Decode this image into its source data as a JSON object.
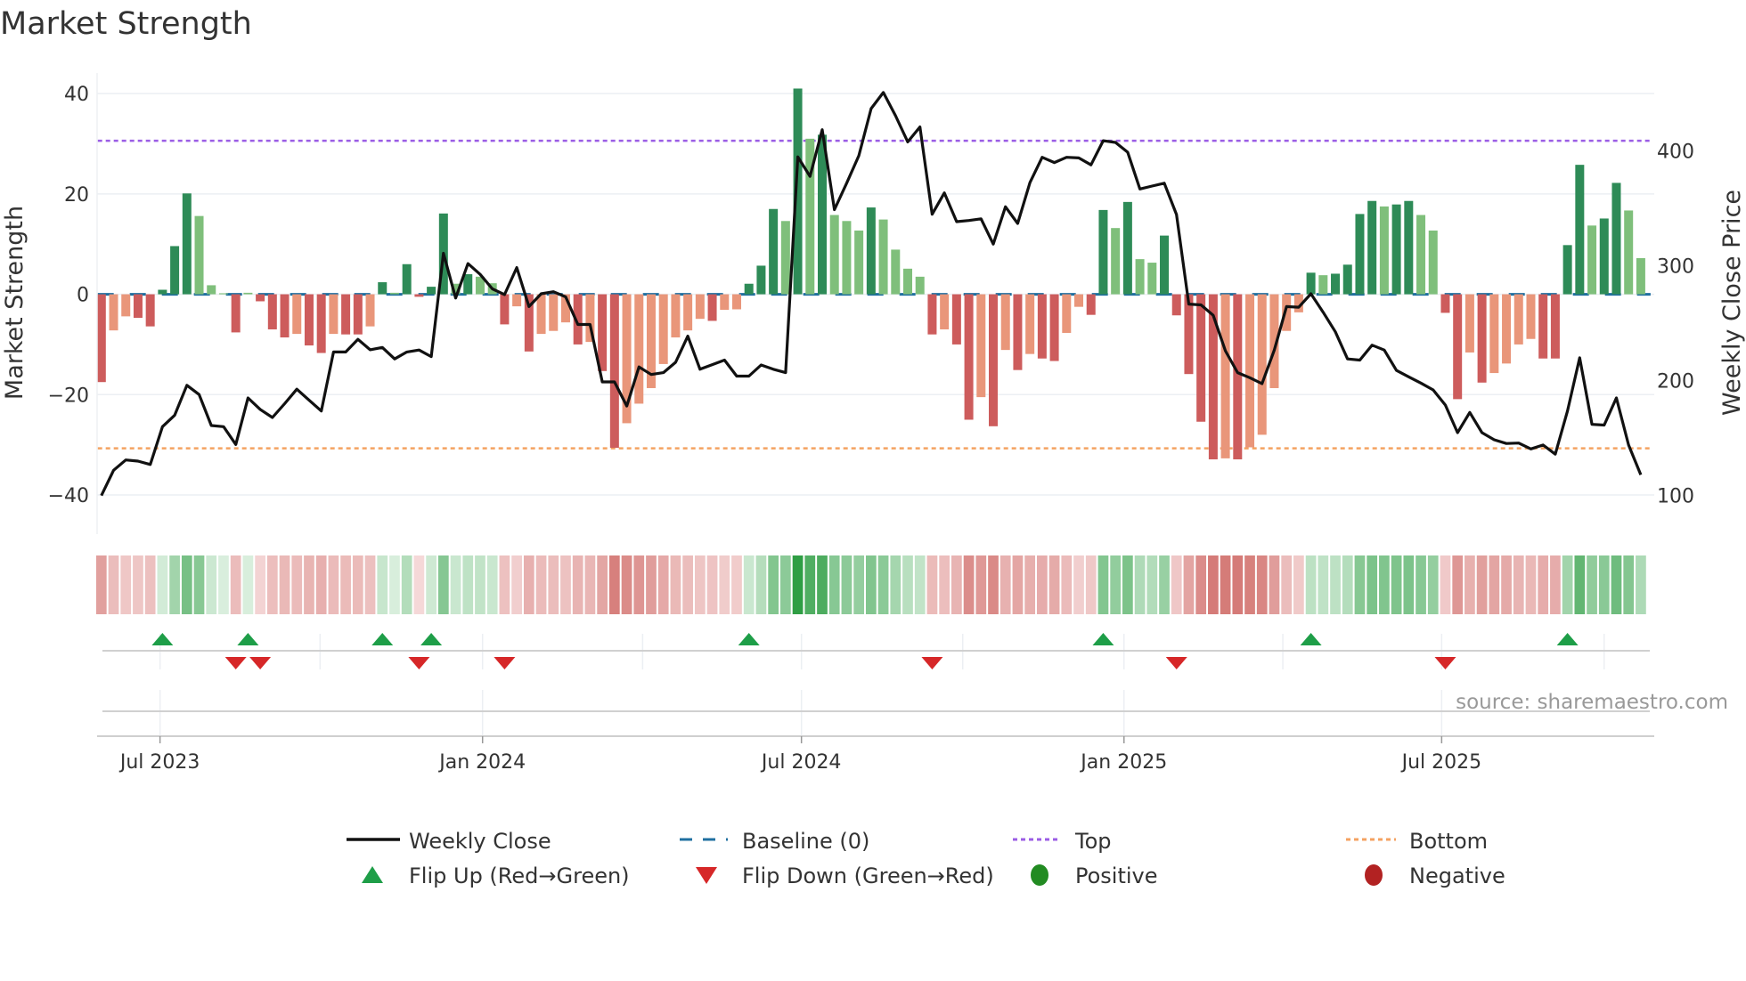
{
  "chart_data": {
    "type": "bar",
    "title": "Market Strength",
    "ylabel": "Market Strength",
    "y2label": "Weekly Close Price",
    "ylim": [
      -47.8,
      44.1
    ],
    "y2lim": [
      66.4,
      468
    ],
    "xlim": [
      -0.35,
      127.1
    ],
    "yticks": [
      40,
      20,
      0,
      -20,
      -40
    ],
    "ytick_labels": [
      "40",
      "20",
      "0",
      "−20",
      "−40"
    ],
    "y2ticks": [
      400,
      300,
      200,
      100
    ],
    "y2tick_labels": [
      "400",
      "300",
      "200",
      "100"
    ],
    "xticks": [
      {
        "label": "Jul 2023",
        "week": 4.8
      },
      {
        "label": "Jan 2024",
        "week": 31.2
      },
      {
        "label": "Jul 2024",
        "week": 57.3
      },
      {
        "label": "Jan 2025",
        "week": 83.7
      },
      {
        "label": "Jul 2025",
        "week": 109.7
      }
    ],
    "minor_xticks": [
      17.9,
      44.3,
      70.5,
      96.7,
      123.0
    ],
    "top": 30.6,
    "bottom": -30.7,
    "baseline": 0,
    "strength": [
      -17.5,
      -7.2,
      -4.4,
      -4.7,
      -6.4,
      0.9,
      9.6,
      20.1,
      15.6,
      1.8,
      0.2,
      -7.6,
      0.3,
      -1.4,
      -7,
      -8.6,
      -7.9,
      -10.2,
      -11.7,
      -7.9,
      -8,
      -8,
      -6.4,
      2.4,
      0.3,
      6,
      -0.5,
      1.5,
      16.1,
      2.1,
      4,
      3.5,
      2.2,
      -6,
      -2.4,
      -11.4,
      -7.9,
      -7.3,
      -5.6,
      -10,
      -9.5,
      -15.3,
      -30.6,
      -25.7,
      -21.8,
      -18.7,
      -13.9,
      -8.6,
      -7.2,
      -4.9,
      -5.3,
      -3.1,
      -3,
      2.1,
      5.7,
      17,
      14.6,
      41,
      31,
      31.8,
      15.8,
      14.6,
      12.7,
      17.3,
      14.9,
      8.9,
      5.1,
      3.5,
      -8,
      -7,
      -10,
      -25,
      -20.5,
      -26.3,
      -11.1,
      -15.1,
      -11.9,
      -12.8,
      -13.3,
      -7.7,
      -2.5,
      -4.1,
      16.8,
      13.2,
      18.4,
      7,
      6.3,
      11.7,
      -4.2,
      -15.9,
      -25.4,
      -32.9,
      -32.7,
      -32.9,
      -30.5,
      -28,
      -18.7,
      -7.3,
      -3.6,
      4.3,
      3.8,
      4.1,
      5.9,
      16,
      18.6,
      17.5,
      17.9,
      18.6,
      15.8,
      12.7,
      -3.7,
      -20.9,
      -11.6,
      -17.6,
      -15.7,
      -13.8,
      -10,
      -8.9,
      -12.8,
      -12.8,
      9.8,
      25.8,
      13.7,
      15.1,
      22.2,
      16.7,
      7.2
    ],
    "strengthening": [
      1,
      0,
      0,
      1,
      1,
      1,
      1,
      1,
      0,
      0,
      0,
      1,
      0,
      1,
      1,
      1,
      0,
      1,
      1,
      0,
      1,
      1,
      0,
      1,
      0,
      1,
      1,
      1,
      1,
      0,
      1,
      0,
      0,
      1,
      0,
      1,
      0,
      0,
      0,
      1,
      0,
      1,
      1,
      0,
      0,
      0,
      0,
      0,
      0,
      0,
      1,
      0,
      0,
      1,
      1,
      1,
      0,
      1,
      0,
      1,
      0,
      0,
      0,
      1,
      0,
      0,
      0,
      0,
      1,
      0,
      1,
      1,
      0,
      1,
      0,
      1,
      0,
      1,
      1,
      0,
      0,
      1,
      1,
      0,
      1,
      0,
      0,
      1,
      1,
      1,
      1,
      1,
      0,
      1,
      0,
      0,
      0,
      0,
      0,
      1,
      0,
      1,
      1,
      1,
      1,
      0,
      1,
      1,
      0,
      0,
      1,
      1,
      0,
      1,
      0,
      0,
      0,
      0,
      1,
      1,
      1,
      1,
      0,
      1,
      1,
      0,
      0
    ],
    "weekly_close": [
      100,
      122,
      131,
      130,
      127,
      160,
      170,
      196,
      188,
      161,
      160,
      144.5,
      185,
      175,
      168,
      180,
      192.6,
      183,
      173.6,
      225,
      225,
      236,
      227,
      229,
      219,
      225,
      226.7,
      221,
      311,
      272,
      302,
      292.6,
      280,
      275,
      298.5,
      264.6,
      275.7,
      277.5,
      273,
      249,
      249,
      199,
      199,
      178,
      212,
      205.4,
      207,
      216,
      238.8,
      210,
      214,
      218,
      204,
      204,
      213.7,
      210,
      207,
      395,
      378,
      418.6,
      349,
      372,
      396,
      437,
      451,
      430.8,
      408,
      421,
      345,
      363.6,
      338.5,
      339.5,
      341,
      319,
      351.5,
      337,
      372.6,
      394.6,
      390,
      394.6,
      394,
      388,
      409,
      407.5,
      399,
      367,
      369.5,
      372,
      344.7,
      266.7,
      266,
      257,
      226,
      207,
      202.6,
      197.4,
      226.7,
      264.6,
      264,
      275.7,
      259.7,
      242.6,
      219,
      218,
      231,
      226.7,
      209,
      203.4,
      198,
      192,
      178.8,
      154.8,
      172.4,
      154.8,
      148.6,
      145.3,
      145.7,
      140.6,
      144,
      136,
      173.6,
      220,
      162,
      161.4,
      185,
      144,
      118
    ],
    "legend": {
      "placement": "bottom",
      "weekly_close": "Weekly Close",
      "baseline": "Baseline (0)",
      "top": "Top",
      "bottom": "Bottom",
      "flip_up": "Flip Up (Red→Green)",
      "flip_down": "Flip Down (Green→Red)",
      "positive": "Positive",
      "negative": "Negative"
    },
    "source": "source: sharemaestro.com"
  },
  "colors": {
    "pos_strong": "#2e8b57",
    "pos_weak": "#7fbf7b",
    "neg_strong": "#cd5c5c",
    "neg_weak": "#e9967a",
    "baseline": "#1f6fa0",
    "top": "#9b5de5",
    "bottom": "#f4a261",
    "close": "#111111",
    "flip_up": "#1e9e48",
    "flip_down": "#d62728",
    "positive": "#228b22",
    "negative": "#b22222"
  }
}
